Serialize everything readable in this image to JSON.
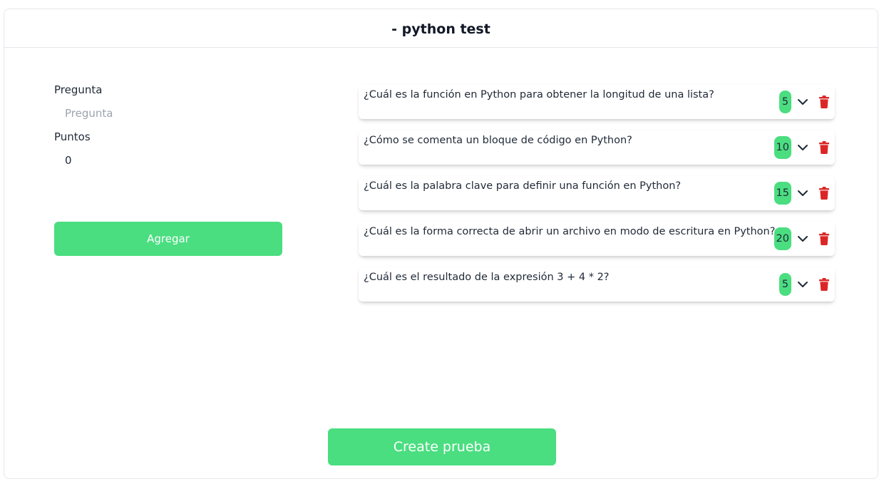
{
  "header": {
    "title": "- python test"
  },
  "form": {
    "question_label": "Pregunta",
    "question_placeholder": "Pregunta",
    "question_value": "",
    "points_label": "Puntos",
    "points_value": "0",
    "add_button": "Agregar"
  },
  "questions": [
    {
      "text": "¿Cuál es la función en Python para obtener la longitud de una lista?",
      "points": "5"
    },
    {
      "text": "¿Cómo se comenta un bloque de código en Python?",
      "points": "10"
    },
    {
      "text": "¿Cuál es la palabra clave para definir una función en Python?",
      "points": "15"
    },
    {
      "text": "¿Cuál es la forma correcta de abrir un archivo en modo de escritura en Python?",
      "points": "20"
    },
    {
      "text": "¿Cuál es el resultado de la expresión 3 + 4 * 2?",
      "points": "5"
    }
  ],
  "footer": {
    "create_button": "Create prueba"
  },
  "icons": {
    "expand": "chevron-down-icon",
    "delete": "trash-icon"
  },
  "colors": {
    "accent": "#4ade80",
    "danger": "#dc2626",
    "border": "#e5e7eb"
  }
}
